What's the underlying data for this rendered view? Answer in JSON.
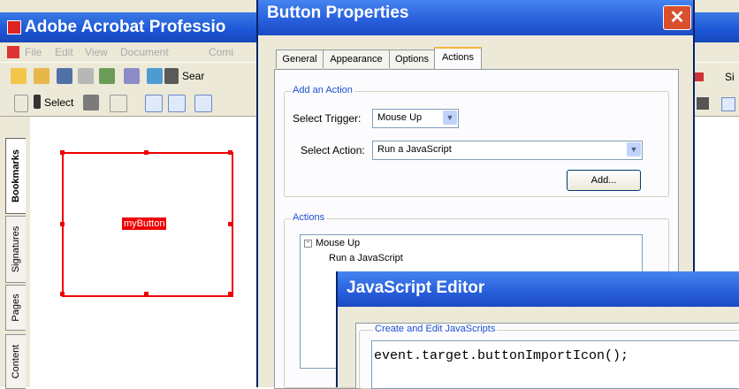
{
  "app": {
    "title": "Adobe Acrobat Professio",
    "menu": [
      "File",
      "Edit",
      "View",
      "Document",
      "Comi"
    ],
    "toolbar": {
      "select_label": "Select",
      "search_label": "Sear",
      "sign_label": "Si"
    },
    "nav_tabs": [
      "Bookmarks",
      "Signatures",
      "Pages",
      "Content"
    ],
    "form_field_label": "myButton"
  },
  "dialog": {
    "title": "Button Properties",
    "close_glyph": "✕",
    "tabs": [
      "General",
      "Appearance",
      "Options",
      "Actions"
    ],
    "active_tab": "Actions",
    "add_action": {
      "group_label": "Add an Action",
      "trigger_label": "Select Trigger:",
      "trigger_value": "Mouse Up",
      "action_label": "Select Action:",
      "action_value": "Run a JavaScript",
      "add_button": "Add..."
    },
    "actions": {
      "group_label": "Actions",
      "items": [
        {
          "event": "Mouse Up",
          "action": "Run a JavaScript"
        }
      ]
    }
  },
  "js_editor": {
    "title": "JavaScript Editor",
    "group_label": "Create and Edit JavaScripts",
    "code": "event.target.buttonImportIcon();"
  },
  "colors": {
    "title_blue": "#2a60dd",
    "selection_red": "#e00000",
    "tab_highlight": "#f8b33d",
    "group_label_blue": "#1d4fd1"
  }
}
